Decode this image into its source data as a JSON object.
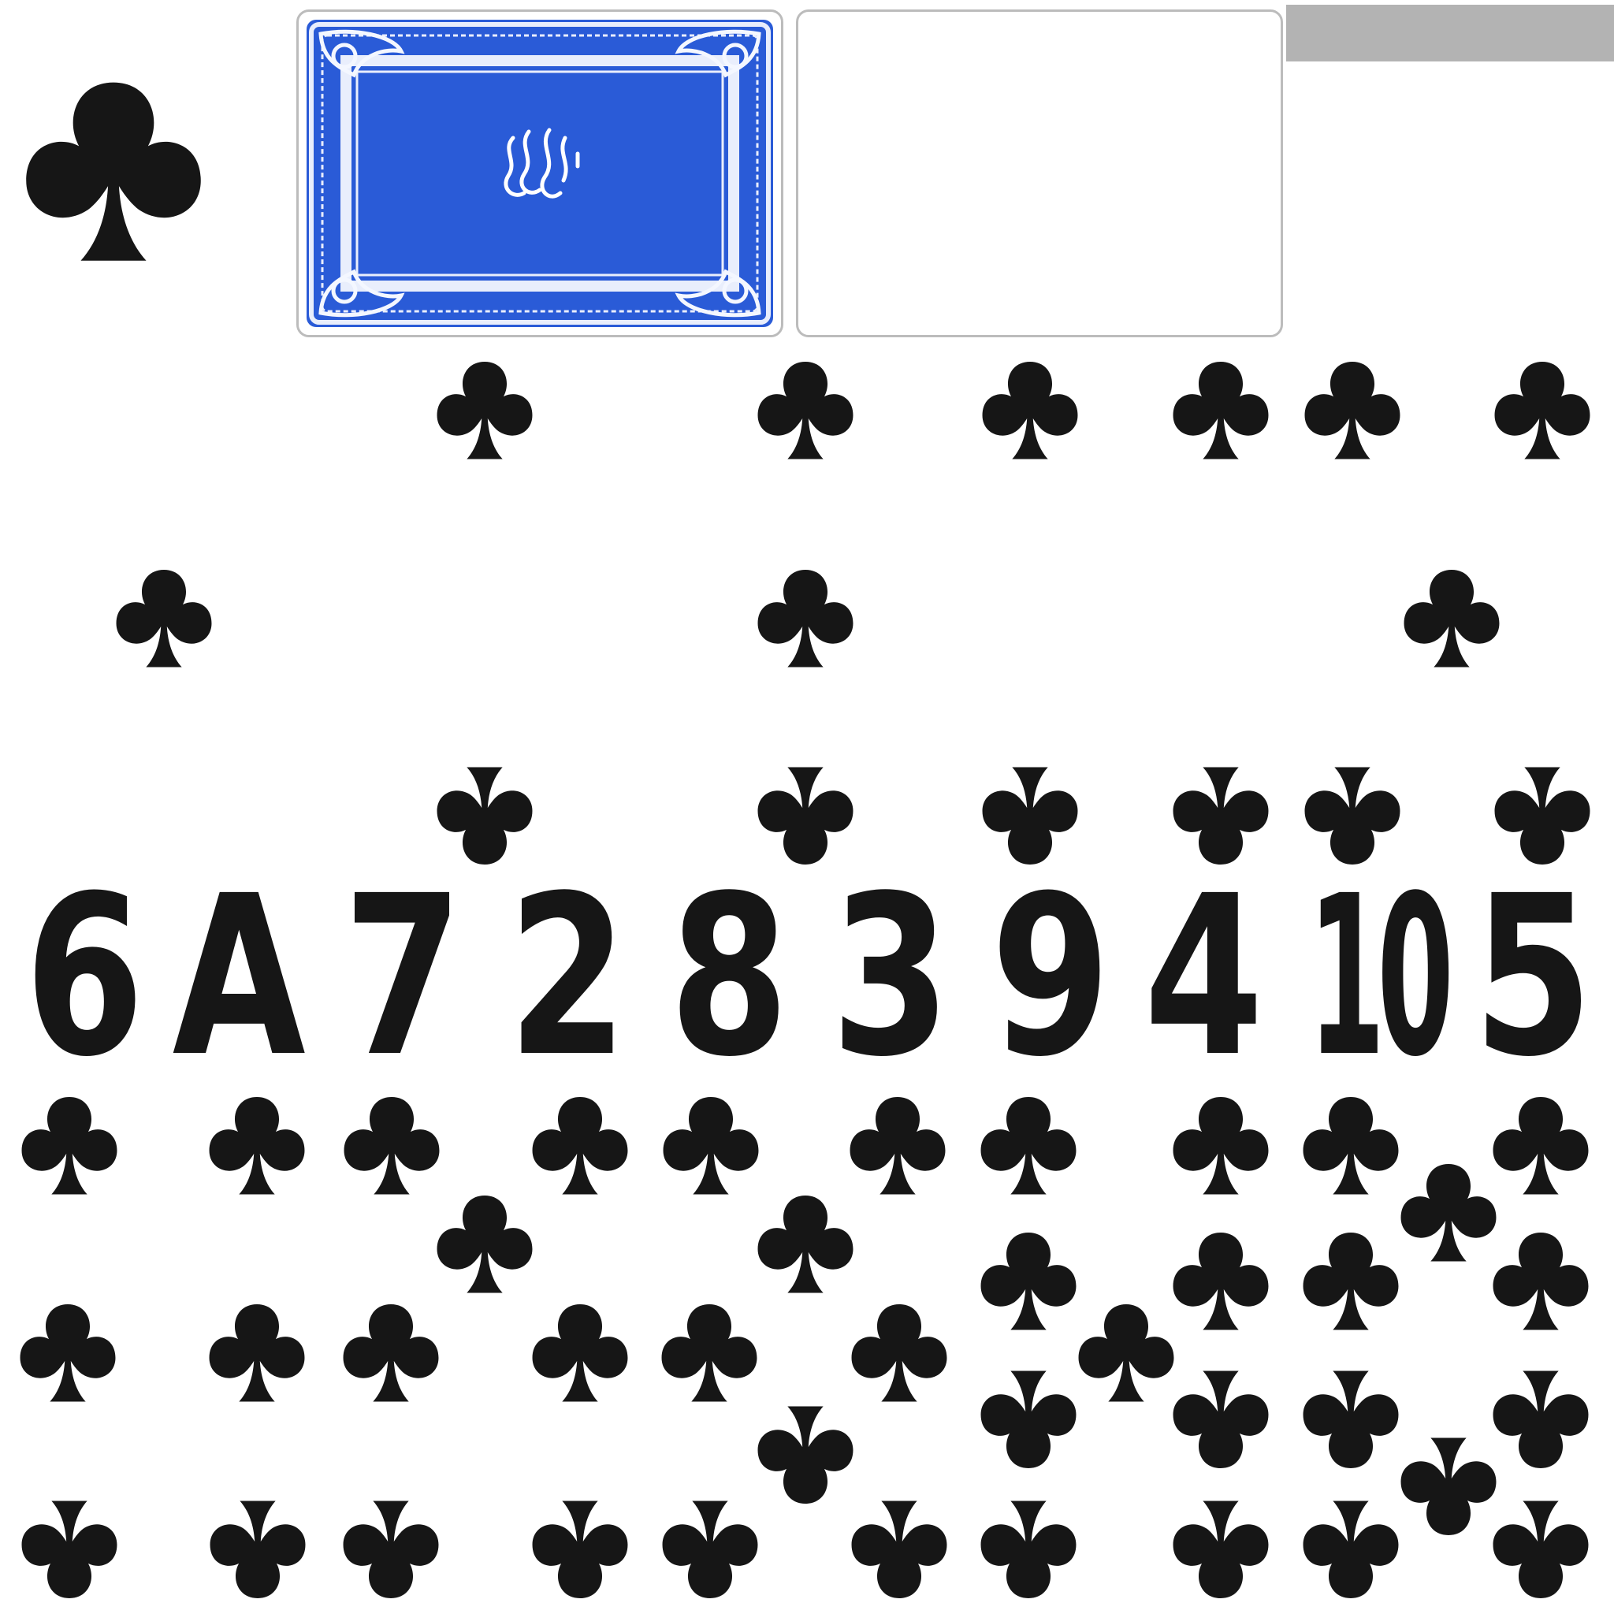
{
  "sheet": {
    "suit": "clubs",
    "suit_icon": "club-icon",
    "ink_color": "#161616",
    "card_back_color": "#2a5bd7",
    "card_back_frame_color": "#e9eefc",
    "slot_border_color": "#bcbcbc",
    "tab_color": "#b3b3b3"
  },
  "card_back": {
    "emblem_icon": "logo-emblem-icon"
  },
  "ranks": [
    "6",
    "A",
    "7",
    "2",
    "8",
    "3",
    "9",
    "4",
    "10",
    "5"
  ]
}
